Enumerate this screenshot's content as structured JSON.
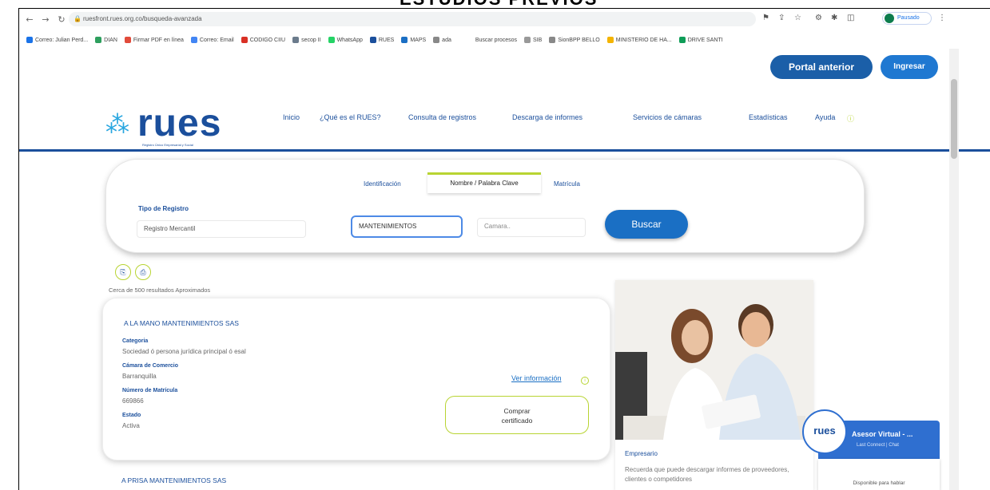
{
  "document": {
    "heading": "ESTUDIOS PREVIOS"
  },
  "browser": {
    "url": "ruesfront.rues.org.co/busqueda-avanzada",
    "profile_label": "Pausado",
    "bookmarks": [
      "Correo: Julian Perd...",
      "DIAN",
      "Firmar PDF en línea",
      "Correo: Email",
      "CODIGO CIIU",
      "secop II",
      "WhatsApp",
      "RUES",
      "MAPS",
      "ada",
      "Buscar procesos",
      "SIB",
      "SionBPP BELLO",
      "MINISTERIO DE HA...",
      "DRIVE SANTI"
    ]
  },
  "header": {
    "portal_button": "Portal anterior",
    "login_button": "Ingresar",
    "logo_text": "rues",
    "logo_tagline": "Registro Único Empresarial y Social",
    "nav": [
      "Inicio",
      "¿Qué es el RUES?",
      "Consulta de registros",
      "Descarga de informes",
      "Servicios de cámaras",
      "Estadísticas",
      "Ayuda"
    ]
  },
  "search": {
    "tabs": [
      "Identificación",
      "Nombre / Palabra Clave",
      "Matrícula"
    ],
    "active_tab": "Nombre / Palabra Clave",
    "tipo_label": "Tipo de Registro",
    "tipo_value": "Registro Mercantil",
    "keyword_value": "MANTENIMIENTOS",
    "camara_placeholder": "Camara..",
    "buscar_button": "Buscar"
  },
  "results": {
    "count_text": "Cerca de 500 resultados Aproximados",
    "items": [
      {
        "name": "A LA MANO MANTENIMIENTOS SAS",
        "labels": {
          "categoria": "Categoria",
          "camara": "Cámara de Comercio",
          "matricula": "Número de Matrícula",
          "estado": "Estado"
        },
        "categoria": "Sociedad ó persona jurídica principal ó esal",
        "camara": "Barranquilla",
        "matricula": "669866",
        "estado": "Activa",
        "more_link": "Ver información",
        "cert_line1": "Comprar",
        "cert_line2": "certificado"
      }
    ],
    "next_name": "A PRISA MANTENIMIENTOS SAS"
  },
  "promo": {
    "title": "Empresario",
    "text": "Recuerda que puede descargar informes de proveedores, clientes o competidores"
  },
  "chat": {
    "name": "Asesor Virtual - ...",
    "status": "Last Connect | Chat",
    "body": "Disponible para hablar"
  },
  "colors": {
    "primary": "#1b4f9c",
    "accent": "#b8d432",
    "button": "#1a6fc4"
  }
}
